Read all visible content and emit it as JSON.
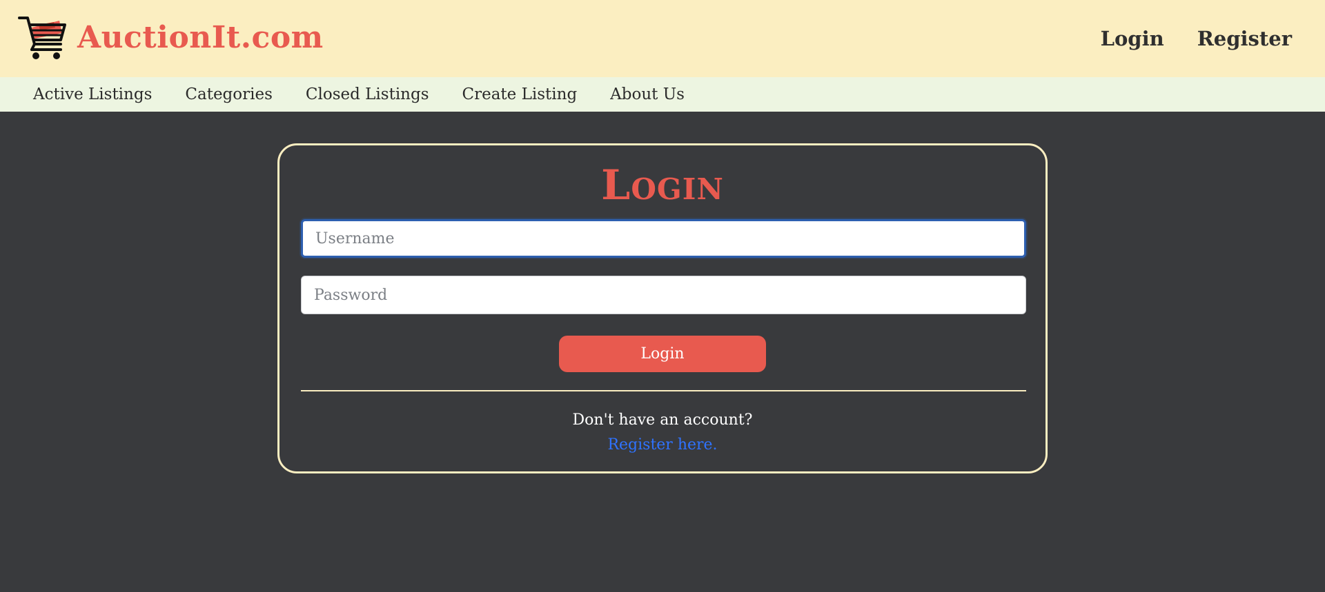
{
  "header": {
    "brand_name": "AuctionIt.com",
    "logo_icon": "shopping-cart-icon",
    "auth_links": [
      {
        "label": "Login"
      },
      {
        "label": "Register"
      }
    ]
  },
  "nav": {
    "items": [
      {
        "label": "Active Listings"
      },
      {
        "label": "Categories"
      },
      {
        "label": "Closed Listings"
      },
      {
        "label": "Create Listing"
      },
      {
        "label": "About Us"
      }
    ]
  },
  "login_form": {
    "title": "Login",
    "username": {
      "value": "",
      "placeholder": "Username"
    },
    "password": {
      "value": "",
      "placeholder": "Password"
    },
    "submit_label": "Login",
    "no_account_text": "Don't have an account?",
    "register_link_text": "Register here."
  },
  "colors": {
    "brand_red": "#e85a4f",
    "header_bg": "#fbeec1",
    "nav_bg": "#edf5e1",
    "page_bg": "#393a3d",
    "link_blue": "#2f73ff"
  }
}
